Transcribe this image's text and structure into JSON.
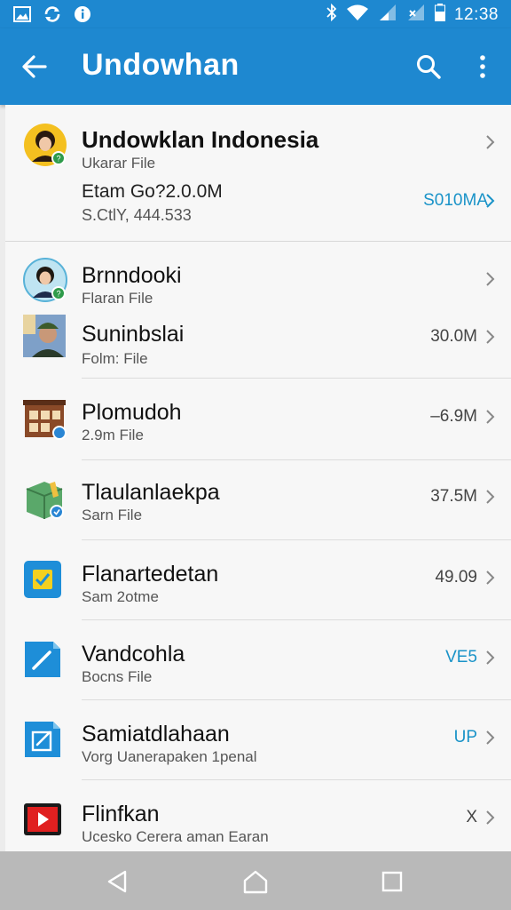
{
  "status_bar": {
    "time": "12:38",
    "left_icons": [
      "gallery-icon",
      "sync-icon",
      "info-icon"
    ],
    "right_icons": [
      "bluetooth-icon",
      "wifi-icon",
      "signal-icon",
      "no-signal-icon",
      "battery-icon"
    ]
  },
  "app_bar": {
    "title": "Undowhan",
    "color": "#1e88d0"
  },
  "featured": {
    "name": "Undowklan Indonesia",
    "subtitle": "Ukarar File",
    "line1": "Etam Go?2.0.0M",
    "line2": "S.CtlY, 444.533",
    "value": "S010MA"
  },
  "items": [
    {
      "name": "Brnndooki",
      "subtitle": "Flaran File",
      "value": "",
      "avatar": "person-avatar"
    },
    {
      "name": "Suninbslai",
      "subtitle": "Folm: File",
      "value": "30.0M",
      "avatar": "person-photo"
    },
    {
      "name": "Plomudoh",
      "subtitle": "2.9m File",
      "value": "–6.9M",
      "avatar": "building-icon"
    },
    {
      "name": "Tlaulanlaekpa",
      "subtitle": "Sarn File",
      "value": "37.5M",
      "avatar": "box-icon"
    },
    {
      "name": "Flanartedetan",
      "subtitle": "Sam 2otme",
      "value": "49.09",
      "avatar": "checkbox-app-icon"
    },
    {
      "name": "Vandcohla",
      "subtitle": "Bocns File",
      "value": "VE5",
      "avatar": "pencil-app-icon"
    },
    {
      "name": "Samiatdlahaan",
      "subtitle": "Vorg Uanerapaken 1penal",
      "value": "UP",
      "avatar": "edit-app-icon"
    },
    {
      "name": "Flinfkan",
      "subtitle": "Ucesko Cerera aman Earan",
      "value": "X",
      "avatar": "video-app-icon"
    }
  ],
  "accent_color": "#1a93c8",
  "nav": {
    "buttons": [
      "back-triangle-icon",
      "home-icon",
      "recents-icon"
    ]
  }
}
